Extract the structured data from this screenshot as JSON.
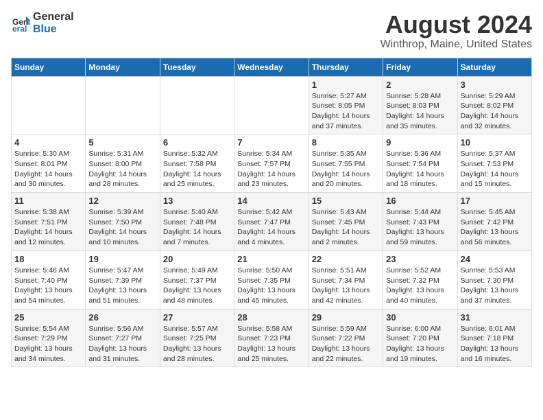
{
  "logo": {
    "general": "General",
    "blue": "Blue"
  },
  "title": "August 2024",
  "subtitle": "Winthrop, Maine, United States",
  "days_of_week": [
    "Sunday",
    "Monday",
    "Tuesday",
    "Wednesday",
    "Thursday",
    "Friday",
    "Saturday"
  ],
  "weeks": [
    [
      {
        "day": "",
        "info": ""
      },
      {
        "day": "",
        "info": ""
      },
      {
        "day": "",
        "info": ""
      },
      {
        "day": "",
        "info": ""
      },
      {
        "day": "1",
        "info": "Sunrise: 5:27 AM\nSunset: 8:05 PM\nDaylight: 14 hours\nand 37 minutes."
      },
      {
        "day": "2",
        "info": "Sunrise: 5:28 AM\nSunset: 8:03 PM\nDaylight: 14 hours\nand 35 minutes."
      },
      {
        "day": "3",
        "info": "Sunrise: 5:29 AM\nSunset: 8:02 PM\nDaylight: 14 hours\nand 32 minutes."
      }
    ],
    [
      {
        "day": "4",
        "info": "Sunrise: 5:30 AM\nSunset: 8:01 PM\nDaylight: 14 hours\nand 30 minutes."
      },
      {
        "day": "5",
        "info": "Sunrise: 5:31 AM\nSunset: 8:00 PM\nDaylight: 14 hours\nand 28 minutes."
      },
      {
        "day": "6",
        "info": "Sunrise: 5:32 AM\nSunset: 7:58 PM\nDaylight: 14 hours\nand 25 minutes."
      },
      {
        "day": "7",
        "info": "Sunrise: 5:34 AM\nSunset: 7:57 PM\nDaylight: 14 hours\nand 23 minutes."
      },
      {
        "day": "8",
        "info": "Sunrise: 5:35 AM\nSunset: 7:55 PM\nDaylight: 14 hours\nand 20 minutes."
      },
      {
        "day": "9",
        "info": "Sunrise: 5:36 AM\nSunset: 7:54 PM\nDaylight: 14 hours\nand 18 minutes."
      },
      {
        "day": "10",
        "info": "Sunrise: 5:37 AM\nSunset: 7:53 PM\nDaylight: 14 hours\nand 15 minutes."
      }
    ],
    [
      {
        "day": "11",
        "info": "Sunrise: 5:38 AM\nSunset: 7:51 PM\nDaylight: 14 hours\nand 12 minutes."
      },
      {
        "day": "12",
        "info": "Sunrise: 5:39 AM\nSunset: 7:50 PM\nDaylight: 14 hours\nand 10 minutes."
      },
      {
        "day": "13",
        "info": "Sunrise: 5:40 AM\nSunset: 7:48 PM\nDaylight: 14 hours\nand 7 minutes."
      },
      {
        "day": "14",
        "info": "Sunrise: 5:42 AM\nSunset: 7:47 PM\nDaylight: 14 hours\nand 4 minutes."
      },
      {
        "day": "15",
        "info": "Sunrise: 5:43 AM\nSunset: 7:45 PM\nDaylight: 14 hours\nand 2 minutes."
      },
      {
        "day": "16",
        "info": "Sunrise: 5:44 AM\nSunset: 7:43 PM\nDaylight: 13 hours\nand 59 minutes."
      },
      {
        "day": "17",
        "info": "Sunrise: 5:45 AM\nSunset: 7:42 PM\nDaylight: 13 hours\nand 56 minutes."
      }
    ],
    [
      {
        "day": "18",
        "info": "Sunrise: 5:46 AM\nSunset: 7:40 PM\nDaylight: 13 hours\nand 54 minutes."
      },
      {
        "day": "19",
        "info": "Sunrise: 5:47 AM\nSunset: 7:39 PM\nDaylight: 13 hours\nand 51 minutes."
      },
      {
        "day": "20",
        "info": "Sunrise: 5:49 AM\nSunset: 7:37 PM\nDaylight: 13 hours\nand 48 minutes."
      },
      {
        "day": "21",
        "info": "Sunrise: 5:50 AM\nSunset: 7:35 PM\nDaylight: 13 hours\nand 45 minutes."
      },
      {
        "day": "22",
        "info": "Sunrise: 5:51 AM\nSunset: 7:34 PM\nDaylight: 13 hours\nand 42 minutes."
      },
      {
        "day": "23",
        "info": "Sunrise: 5:52 AM\nSunset: 7:32 PM\nDaylight: 13 hours\nand 40 minutes."
      },
      {
        "day": "24",
        "info": "Sunrise: 5:53 AM\nSunset: 7:30 PM\nDaylight: 13 hours\nand 37 minutes."
      }
    ],
    [
      {
        "day": "25",
        "info": "Sunrise: 5:54 AM\nSunset: 7:29 PM\nDaylight: 13 hours\nand 34 minutes."
      },
      {
        "day": "26",
        "info": "Sunrise: 5:56 AM\nSunset: 7:27 PM\nDaylight: 13 hours\nand 31 minutes."
      },
      {
        "day": "27",
        "info": "Sunrise: 5:57 AM\nSunset: 7:25 PM\nDaylight: 13 hours\nand 28 minutes."
      },
      {
        "day": "28",
        "info": "Sunrise: 5:58 AM\nSunset: 7:23 PM\nDaylight: 13 hours\nand 25 minutes."
      },
      {
        "day": "29",
        "info": "Sunrise: 5:59 AM\nSunset: 7:22 PM\nDaylight: 13 hours\nand 22 minutes."
      },
      {
        "day": "30",
        "info": "Sunrise: 6:00 AM\nSunset: 7:20 PM\nDaylight: 13 hours\nand 19 minutes."
      },
      {
        "day": "31",
        "info": "Sunrise: 6:01 AM\nSunset: 7:18 PM\nDaylight: 13 hours\nand 16 minutes."
      }
    ]
  ]
}
